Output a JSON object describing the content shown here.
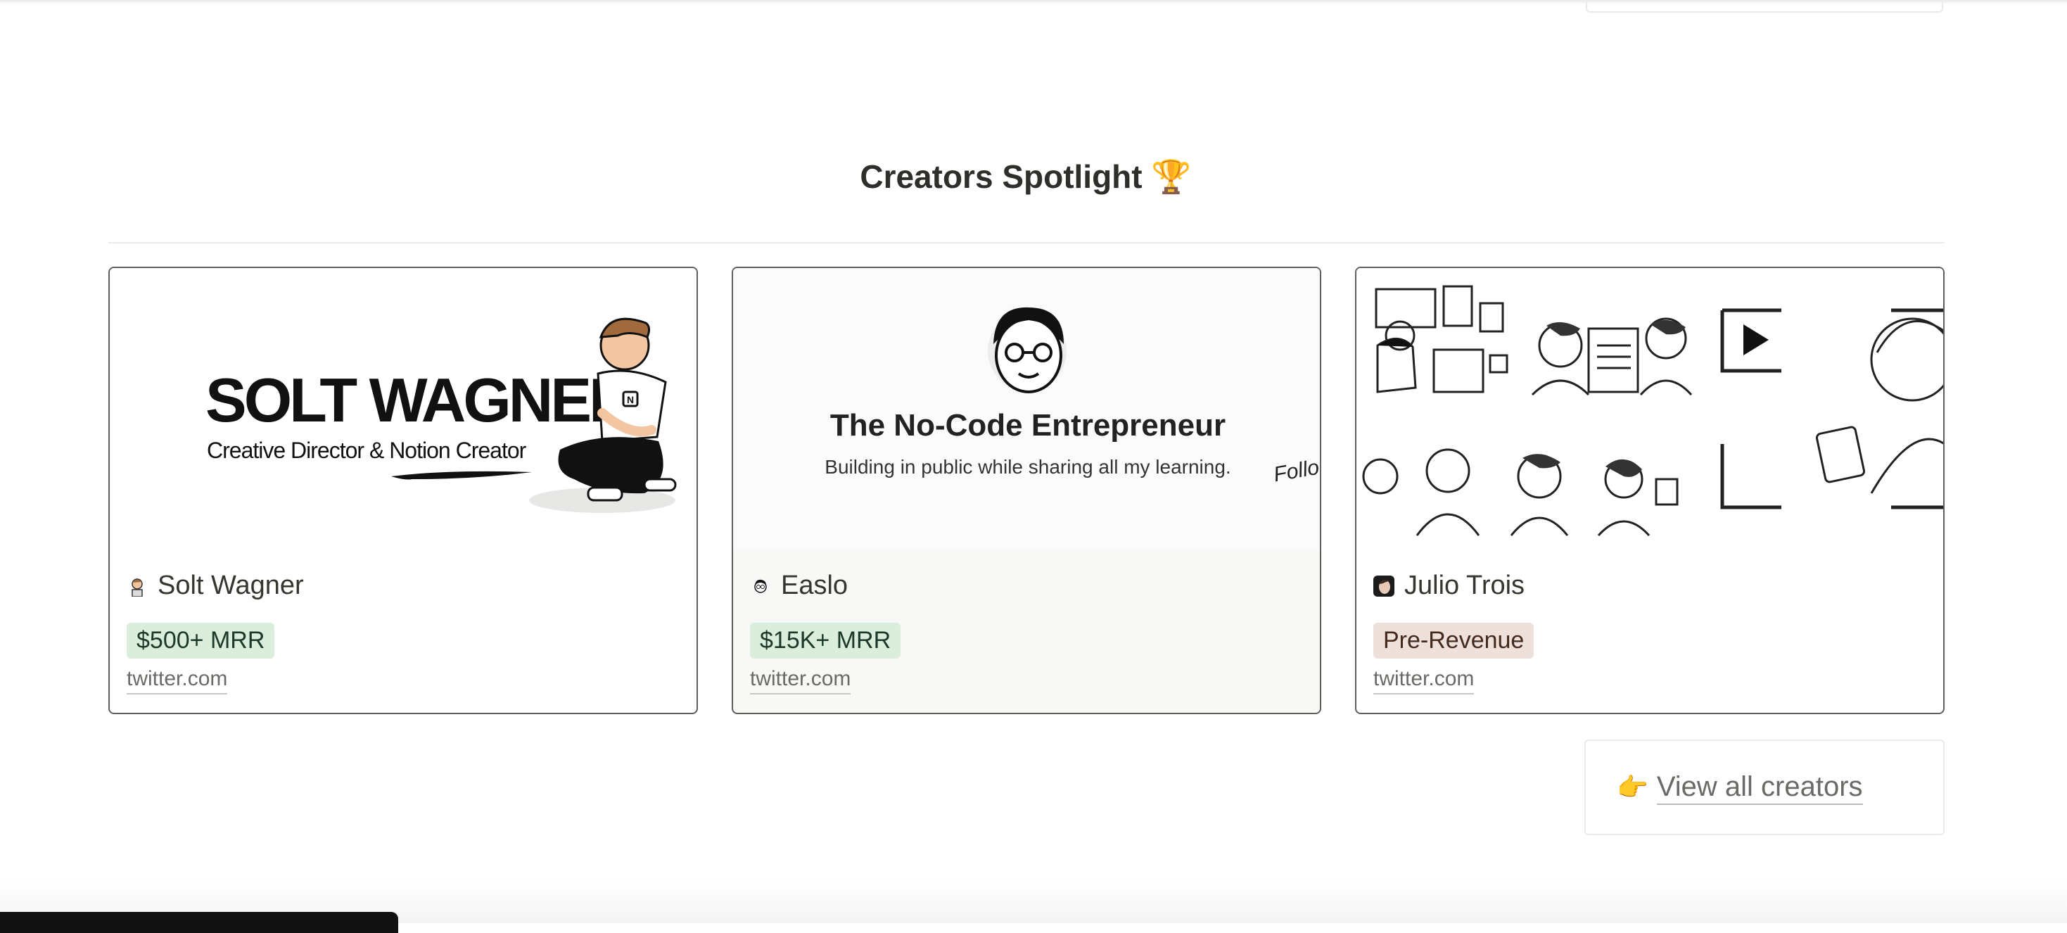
{
  "section": {
    "title": "Creators Spotlight 🏆"
  },
  "cards": [
    {
      "cover_title": "SOLT WAGNER",
      "cover_subtitle": "Creative Director & Notion Creator",
      "name": "Solt Wagner",
      "badge": "$500+ MRR",
      "link": "twitter.com"
    },
    {
      "cover_title": "The No-Code Entrepreneur",
      "cover_subtitle": "Building in public while sharing all my learning.",
      "cover_aside": "Follo",
      "name": "Easlo",
      "badge": "$15K+ MRR",
      "link": "twitter.com"
    },
    {
      "name": "Julio Trois",
      "badge": "Pre-Revenue",
      "link": "twitter.com"
    }
  ],
  "view_all": {
    "emoji": "👉",
    "label": "View all creators"
  },
  "colors": {
    "badge_green": "#dbeddb",
    "badge_brown": "#eee0da",
    "card_border": "#5f5e5b"
  }
}
